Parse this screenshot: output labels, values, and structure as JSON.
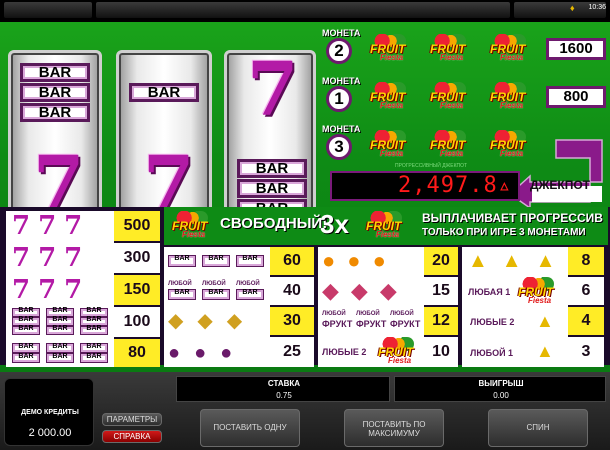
{
  "status": {
    "clock": "10:36"
  },
  "coins": {
    "label": "МОНЕТА",
    "rows": [
      {
        "coin": "2",
        "payout": "1600"
      },
      {
        "coin": "1",
        "payout": "800"
      },
      {
        "coin": "3",
        "payout": ""
      }
    ]
  },
  "logo": {
    "line1": "FRUIT",
    "line2": "Fiesta"
  },
  "jackpot": {
    "value": "2,497.8",
    "label": "ДЖЕКПОТ",
    "sublabel": "ПРОГРЕССИВНЫЙ ДЖЕКПОТ"
  },
  "banner": {
    "free": "СВОБОДНЫЙ!",
    "multiplier": "3x",
    "line1": "ВЫПЛАЧИВАЕТ ПРОГРЕССИВ",
    "line2": "ТОЛЬКО ПРИ ИГРЕ 3 МОНЕТАМИ"
  },
  "paytable": {
    "col1": [
      "500",
      "300",
      "150",
      "100",
      "80"
    ],
    "col2": [
      "60",
      "40",
      "30",
      "25"
    ],
    "col2_any": "ЛЮБОЙ",
    "col3": [
      "20",
      "15",
      "12",
      "10"
    ],
    "col3_any": "ЛЮБОЙ",
    "col3_fruit": "ФРУКТ",
    "col3_any2": "ЛЮБЫЕ 2",
    "col4": [
      "8",
      "6",
      "4",
      "3"
    ],
    "col4_any1": "ЛЮБАЯ 1",
    "col4_any2": "ЛЮБЫЕ 2",
    "col4_any1b": "ЛЮБОЙ 1",
    "bar": "BAR"
  },
  "bottom": {
    "credits_label": "ДЕМО КРЕДИТЫ",
    "credits_value": "2 000.00",
    "params": "ПАРАМЕТРЫ",
    "help": "СПРАВКА",
    "bet_label": "СТАВКА",
    "bet_value": "0.75",
    "win_label": "ВЫИГРЫШ",
    "win_value": "0.00",
    "bet_one": "ПОСТАВИТЬ ОДНУ",
    "bet_max": "ПОСТАВИТЬ ПО МАКСИМУМУ",
    "spin": "СПИН"
  }
}
